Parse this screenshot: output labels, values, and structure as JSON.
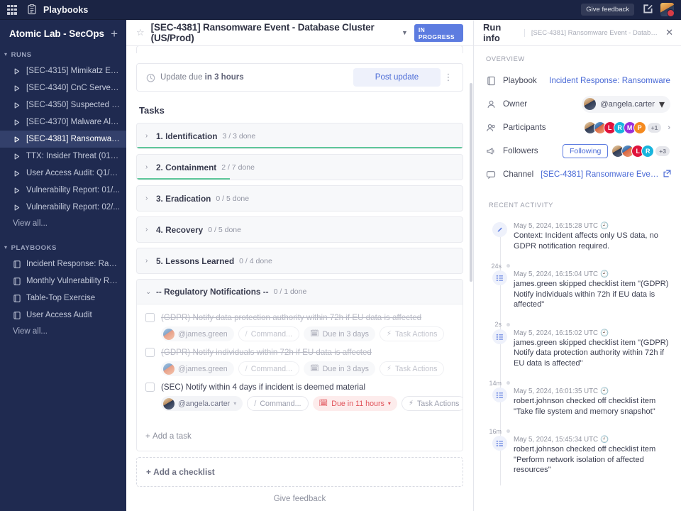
{
  "topbar": {
    "app_title": "Playbooks",
    "grid_icon": "apps-grid-icon",
    "book_icon": "playbook-icon",
    "feedback_label": "Give feedback",
    "compose_icon": "compose-icon",
    "avatar_icon": "user-avatar"
  },
  "sidebar": {
    "team_name": "Atomic Lab - SecOps",
    "add_label": "+",
    "runs_section": "RUNS",
    "playbooks_section": "PLAYBOOKS",
    "view_all": "View all...",
    "runs": [
      {
        "label": "[SEC-4315] Mimikatz Exe...",
        "active": false
      },
      {
        "label": "[SEC-4340] CnC Server D...",
        "active": false
      },
      {
        "label": "[SEC-4350] Suspected Sp...",
        "active": false
      },
      {
        "label": "[SEC-4370] Malware Alert...",
        "active": false
      },
      {
        "label": "[SEC-4381] Ransomware ...",
        "active": true
      },
      {
        "label": "TTX: Insider Threat (01/2...",
        "active": false
      },
      {
        "label": "User Access Audit: Q1/20...",
        "active": false
      },
      {
        "label": "Vulnerability Report: 01/...",
        "active": false
      },
      {
        "label": "Vulnerability Report: 02/...",
        "active": false
      }
    ],
    "playbooks": [
      {
        "label": "Incident Response: Rans..."
      },
      {
        "label": "Monthly Vulnerability Re..."
      },
      {
        "label": "Table-Top Exercise"
      },
      {
        "label": "User Access Audit"
      }
    ]
  },
  "center": {
    "star_icon": "star-icon",
    "run_title": "[SEC-4381] Ransomware Event - Database Cluster (US/Prod)",
    "status_badge": "IN PROGRESS",
    "update_due": "Update due ",
    "update_due_bold": "in 3 hours",
    "post_update_label": "Post update",
    "tasks_heading": "Tasks",
    "add_task_label": "Add a task",
    "add_checklist_label": "Add a checklist",
    "give_feedback_label": "Give feedback",
    "checklists": [
      {
        "title": "1. Identification",
        "count": "3 / 3 done",
        "progress": 100,
        "open": false
      },
      {
        "title": "2. Containment",
        "count": "2 / 7 done",
        "progress": 28.5,
        "open": false
      },
      {
        "title": "3. Eradication",
        "count": "0 / 5 done",
        "progress": 0,
        "open": false
      },
      {
        "title": "4. Recovery",
        "count": "0 / 5 done",
        "progress": 0,
        "open": false
      },
      {
        "title": "5. Lessons Learned",
        "count": "0 / 4 done",
        "progress": 0,
        "open": false
      },
      {
        "title": "-- Regulatory Notifications --",
        "count": "0 / 1 done",
        "progress": 0,
        "open": true
      }
    ],
    "tasks": [
      {
        "text": "(GDPR) Notify data protection authority within 72h if EU data is affected",
        "skipped": true,
        "assignee": "@james.green",
        "command": "Command...",
        "due": "Due in 3 days",
        "due_overdue": false,
        "actions": "Task Actions"
      },
      {
        "text": "(GDPR) Notify individuals within 72h if EU data is affected",
        "skipped": true,
        "assignee": "@james.green",
        "command": "Command...",
        "due": "Due in 3 days",
        "due_overdue": false,
        "actions": "Task Actions"
      },
      {
        "text": "(SEC) Notify within 4 days if incident is deemed material",
        "skipped": false,
        "assignee": "@angela.carter",
        "command": "Command...",
        "due": "Due in 11 hours",
        "due_overdue": true,
        "actions": "Task Actions"
      }
    ]
  },
  "rhs": {
    "title": "Run info",
    "subtitle": "[SEC-4381] Ransomware Event - Database ...",
    "close_icon": "close-icon",
    "overview_label": "OVERVIEW",
    "rows": {
      "playbook_label": "Playbook",
      "playbook_value": "Incident Response: Ransomware",
      "owner_label": "Owner",
      "owner_value": "@angela.carter",
      "participants_label": "Participants",
      "participants_more": "+1",
      "followers_label": "Followers",
      "following_label": "Following",
      "followers_more": "+3",
      "channel_label": "Channel",
      "channel_value": "[SEC-4381] Ransomware Event - Da"
    },
    "participants_avatars": [
      {
        "type": "photo",
        "style": "angela"
      },
      {
        "type": "photo",
        "style": "james"
      },
      {
        "type": "letter",
        "letter": "L",
        "color": "#e0143c"
      },
      {
        "type": "letter",
        "letter": "R",
        "color": "#19b5dd"
      },
      {
        "type": "letter",
        "letter": "M",
        "color": "#9b30d9"
      },
      {
        "type": "letter",
        "letter": "P",
        "color": "#f58a1f"
      }
    ],
    "followers_avatars": [
      {
        "type": "photo",
        "style": "angela"
      },
      {
        "type": "photo",
        "style": "james"
      },
      {
        "type": "letter",
        "letter": "L",
        "color": "#e0143c"
      },
      {
        "type": "letter",
        "letter": "R",
        "color": "#19b5dd"
      }
    ],
    "activity_label": "RECENT ACTIVITY",
    "activity": [
      {
        "icon": "pencil-icon",
        "time": "May 5, 2024, 16:15:28 UTC",
        "text": "Context: Incident affects only US data, no GDPR notification required.",
        "gap": "24s"
      },
      {
        "icon": "checklist-icon",
        "time": "May 5, 2024, 16:15:04 UTC",
        "text": "james.green skipped checklist item \"(GDPR) Notify individuals within 72h if EU data is affected\"",
        "gap": "2s"
      },
      {
        "icon": "checklist-icon",
        "time": "May 5, 2024, 16:15:02 UTC",
        "text": "james.green skipped checklist item \"(GDPR) Notify data protection authority within 72h if EU data is affected\"",
        "gap": "14m"
      },
      {
        "icon": "checklist-icon",
        "time": "May 5, 2024, 16:01:35 UTC",
        "text": "robert.johnson checked off checklist item \"Take file system and memory snapshot\"",
        "gap": "16m"
      },
      {
        "icon": "checklist-icon",
        "time": "May 5, 2024, 15:45:34 UTC",
        "text": "robert.johnson checked off checklist item \"Perform network isolation of affected resources\"",
        "gap": ""
      }
    ]
  },
  "colors": {
    "sidebar_bg": "#1f2a50",
    "topbar_bg": "#1b2444",
    "accent_blue": "#4a6ad6",
    "badge_blue": "#5d7ce0",
    "progress_green": "#5fc79a",
    "overdue_red": "#e0535a"
  }
}
